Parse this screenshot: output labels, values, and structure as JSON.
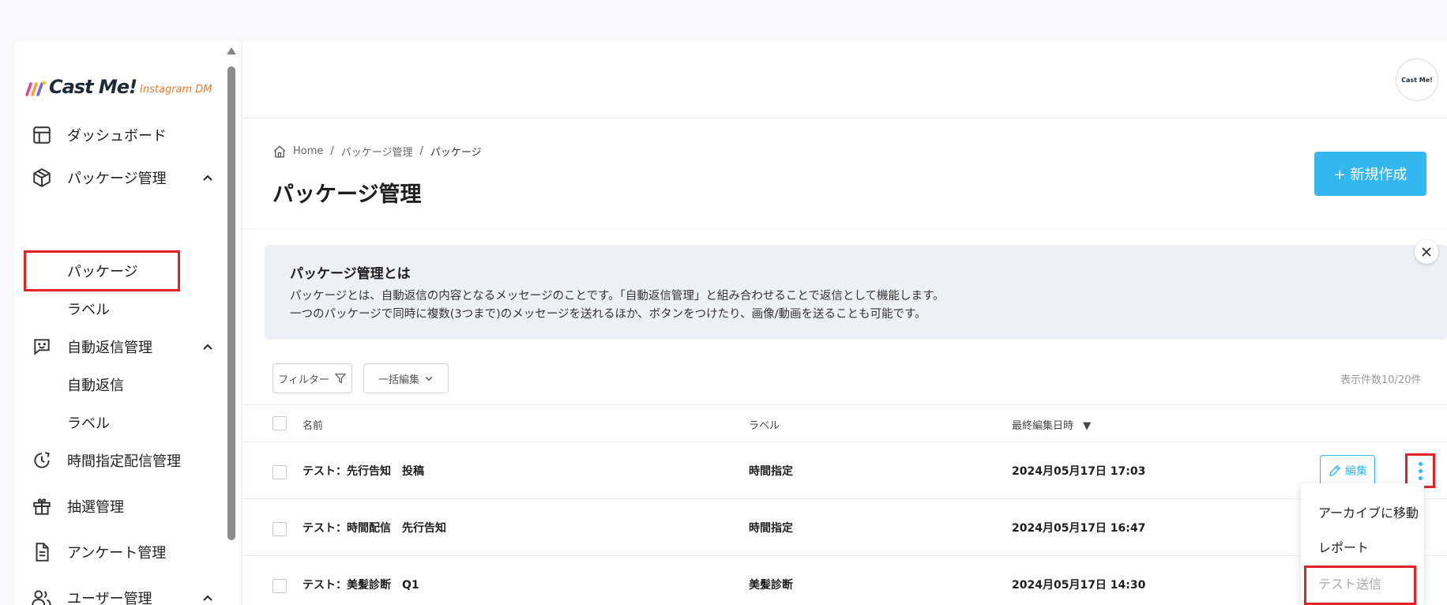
{
  "brand": {
    "name": "Cast Me!",
    "sub": "Instagram DM"
  },
  "sidebar": {
    "dashboard": "ダッシュボード",
    "package_mgmt": "パッケージ管理",
    "package": "パッケージ",
    "label1": "ラベル",
    "autoreply_mgmt": "自動返信管理",
    "autoreply": "自動返信",
    "label2": "ラベル",
    "scheduled": "時間指定配信管理",
    "lottery": "抽選管理",
    "survey": "アンケート管理",
    "user_mgmt": "ユーザー管理"
  },
  "avatar_text": "Cast Me!",
  "breadcrumb": {
    "home": "Home",
    "sep": "/",
    "level1": "パッケージ管理",
    "current": "パッケージ"
  },
  "page_title": "パッケージ管理",
  "new_button": "+ 新規作成",
  "info": {
    "title": "パッケージ管理とは",
    "line1": "パッケージとは、自動返信の内容となるメッセージのことです。「自動返信管理」と組み合わせることで返信として機能します。",
    "line2": "一つのパッケージで同時に複数(3つまで)のメッセージを送れるほか、ボタンをつけたり、画像/動画を送ることも可能です。"
  },
  "toolbar": {
    "filter": "フィルター",
    "bulk_edit": "一括編集",
    "count": "表示件数10/20件"
  },
  "table": {
    "headers": {
      "name": "名前",
      "label": "ラベル",
      "updated": "最終編集日時",
      "sort_icon": "▼"
    },
    "rows": [
      {
        "name": "テスト：先行告知　投稿",
        "label": "時間指定",
        "updated": "2024月05月17日 17:03"
      },
      {
        "name": "テスト：時間配信　先行告知",
        "label": "時間指定",
        "updated": "2024月05月17日 16:47"
      },
      {
        "name": "テスト：美髪診断　Q1",
        "label": "美髪診断",
        "updated": "2024月05月17日 14:30"
      }
    ],
    "edit_label": "編集"
  },
  "dropdown": {
    "archive": "アーカイブに移動",
    "report": "レポート",
    "test_send": "テスト送信"
  },
  "colors": {
    "accent": "#33b7f0",
    "highlight": "#e02424",
    "brand_orange": "#f07a2b"
  }
}
